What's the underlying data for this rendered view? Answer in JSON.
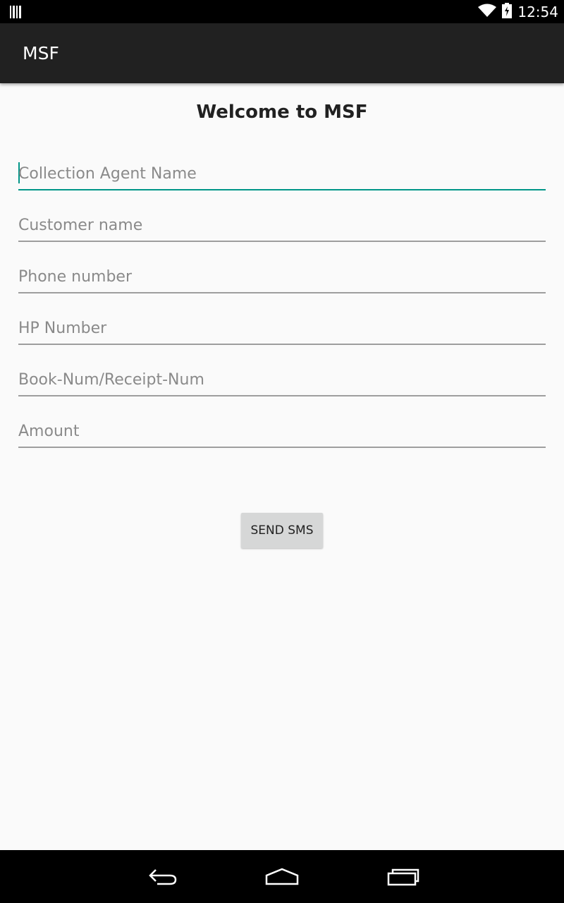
{
  "status_bar": {
    "time": "12:54",
    "icons": [
      "barcode-notification-icon",
      "wifi-icon",
      "battery-charging-icon"
    ]
  },
  "app_bar": {
    "title": "MSF"
  },
  "main": {
    "heading": "Welcome to MSF",
    "fields": [
      {
        "name": "collection-agent-name-field",
        "placeholder": "Collection Agent Name",
        "value": "",
        "focused": true
      },
      {
        "name": "customer-name-field",
        "placeholder": "Customer name",
        "value": "",
        "focused": false
      },
      {
        "name": "phone-number-field",
        "placeholder": "Phone number",
        "value": "",
        "focused": false
      },
      {
        "name": "hp-number-field",
        "placeholder": "HP Number",
        "value": "",
        "focused": false
      },
      {
        "name": "book-receipt-number-field",
        "placeholder": "Book-Num/Receipt-Num",
        "value": "",
        "focused": false
      },
      {
        "name": "amount-field",
        "placeholder": "Amount",
        "value": "",
        "focused": false
      }
    ],
    "send_button_label": "SEND SMS"
  },
  "nav_bar": {
    "icons": [
      "back-icon",
      "home-icon",
      "recents-icon"
    ]
  },
  "colors": {
    "accent": "#009688",
    "app_bar": "#212121",
    "background": "#fafafa",
    "button": "#d6d7d7"
  }
}
